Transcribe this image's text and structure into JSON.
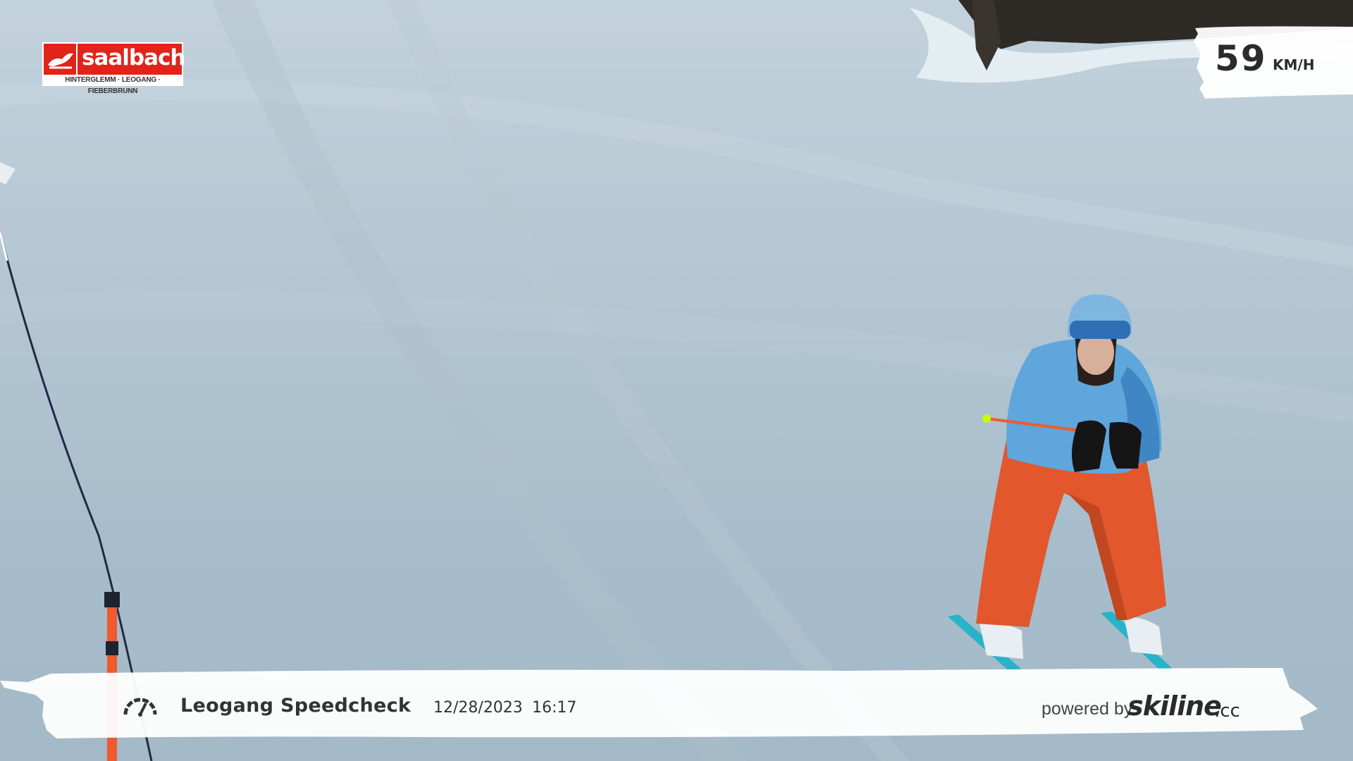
{
  "logo": {
    "name": "saalbach",
    "tagline": "HINTERGLEMM · LEOGANG · FIEBERBRUNN",
    "brand_color": "#e2231a"
  },
  "speed": {
    "value": "59",
    "unit": "KM/H"
  },
  "info_bar": {
    "icon": "speedometer-icon",
    "location": "Leogang Speedcheck",
    "date": "12/28/2023",
    "time": "16:17",
    "powered_by": "powered by",
    "brand": "skiline",
    "brand_tld": ".cc"
  },
  "colors": {
    "snow": "#b5c7d3",
    "jacket": "#5ea6dc",
    "pants": "#e2572b",
    "overlay_text": "#2b2b2b"
  }
}
